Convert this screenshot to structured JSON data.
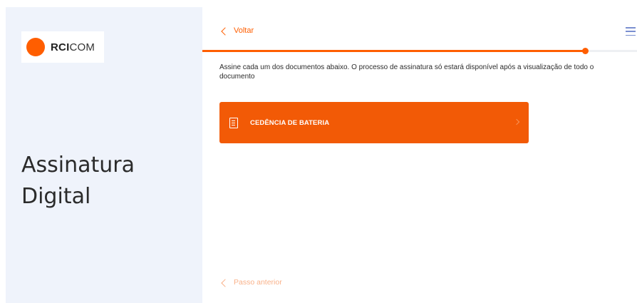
{
  "brand": {
    "logo_bold": "RCI",
    "logo_light": "COM",
    "accent_color": "#ff5e00"
  },
  "sidebar": {
    "title_line1": "Assinatura",
    "title_line2": "Digital"
  },
  "header": {
    "back_label": "Voltar",
    "menu_icon": "hamburger-menu-icon"
  },
  "progress": {
    "fraction": 0.88
  },
  "main": {
    "instructions": "Assine cada um dos documentos abaixo. O processo de assinatura só estará disponível após a visualização de todo o documento",
    "documents": [
      {
        "label": "CEDÊNCIA DE BATERIA",
        "icon": "document-icon"
      }
    ]
  },
  "footer": {
    "prev_label": "Passo anterior"
  }
}
